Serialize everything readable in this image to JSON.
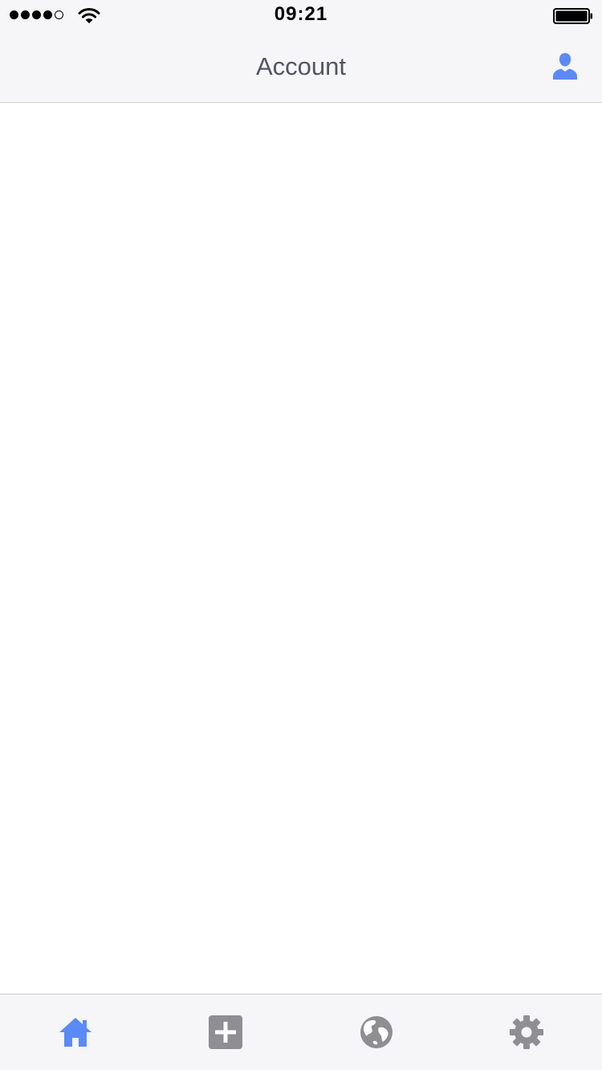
{
  "status_bar": {
    "time": "09:21",
    "signal_bars_filled": 4,
    "signal_bars_total": 5,
    "battery_level": 1.0
  },
  "nav": {
    "title": "Account",
    "right_icon": "person-icon"
  },
  "colors": {
    "accent": "#5b8af7",
    "inactive_icon": "#8e8e93",
    "bar_background": "#f6f6f8",
    "title_text": "#525463"
  },
  "tabs": [
    {
      "icon": "home-icon",
      "active": true
    },
    {
      "icon": "plus-square-icon",
      "active": false
    },
    {
      "icon": "globe-icon",
      "active": false
    },
    {
      "icon": "gear-icon",
      "active": false
    }
  ]
}
